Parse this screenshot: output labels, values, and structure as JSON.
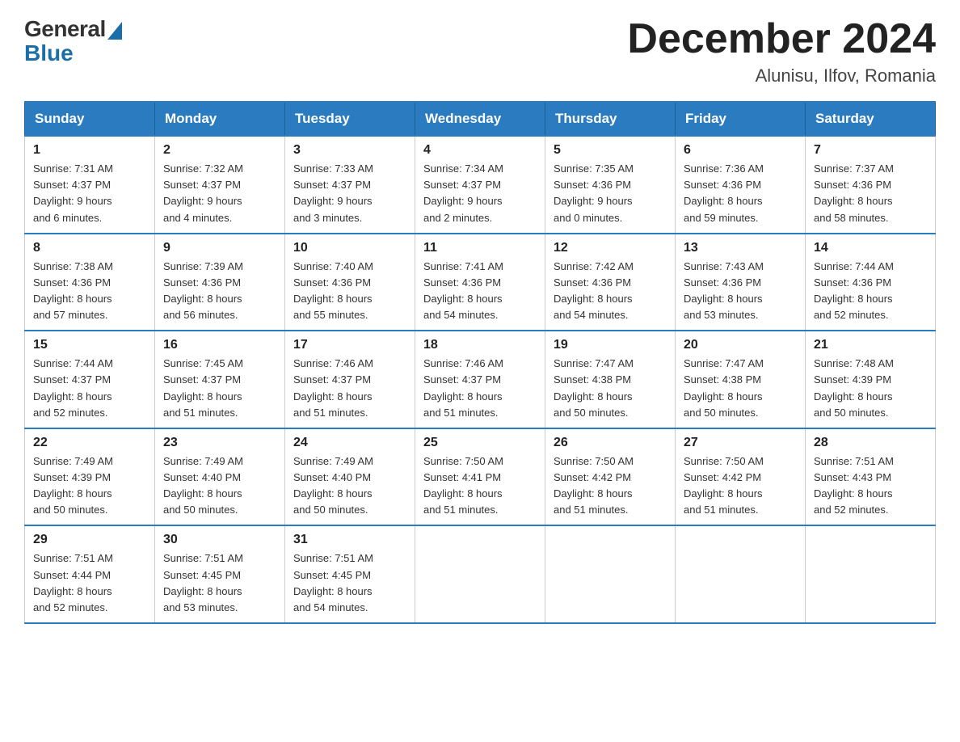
{
  "header": {
    "logo_general": "General",
    "logo_blue": "Blue",
    "month_title": "December 2024",
    "location": "Alunisu, Ilfov, Romania"
  },
  "days_of_week": [
    "Sunday",
    "Monday",
    "Tuesday",
    "Wednesday",
    "Thursday",
    "Friday",
    "Saturday"
  ],
  "weeks": [
    [
      {
        "day": "1",
        "sunrise": "7:31 AM",
        "sunset": "4:37 PM",
        "daylight": "9 hours and 6 minutes."
      },
      {
        "day": "2",
        "sunrise": "7:32 AM",
        "sunset": "4:37 PM",
        "daylight": "9 hours and 4 minutes."
      },
      {
        "day": "3",
        "sunrise": "7:33 AM",
        "sunset": "4:37 PM",
        "daylight": "9 hours and 3 minutes."
      },
      {
        "day": "4",
        "sunrise": "7:34 AM",
        "sunset": "4:37 PM",
        "daylight": "9 hours and 2 minutes."
      },
      {
        "day": "5",
        "sunrise": "7:35 AM",
        "sunset": "4:36 PM",
        "daylight": "9 hours and 0 minutes."
      },
      {
        "day": "6",
        "sunrise": "7:36 AM",
        "sunset": "4:36 PM",
        "daylight": "8 hours and 59 minutes."
      },
      {
        "day": "7",
        "sunrise": "7:37 AM",
        "sunset": "4:36 PM",
        "daylight": "8 hours and 58 minutes."
      }
    ],
    [
      {
        "day": "8",
        "sunrise": "7:38 AM",
        "sunset": "4:36 PM",
        "daylight": "8 hours and 57 minutes."
      },
      {
        "day": "9",
        "sunrise": "7:39 AM",
        "sunset": "4:36 PM",
        "daylight": "8 hours and 56 minutes."
      },
      {
        "day": "10",
        "sunrise": "7:40 AM",
        "sunset": "4:36 PM",
        "daylight": "8 hours and 55 minutes."
      },
      {
        "day": "11",
        "sunrise": "7:41 AM",
        "sunset": "4:36 PM",
        "daylight": "8 hours and 54 minutes."
      },
      {
        "day": "12",
        "sunrise": "7:42 AM",
        "sunset": "4:36 PM",
        "daylight": "8 hours and 54 minutes."
      },
      {
        "day": "13",
        "sunrise": "7:43 AM",
        "sunset": "4:36 PM",
        "daylight": "8 hours and 53 minutes."
      },
      {
        "day": "14",
        "sunrise": "7:44 AM",
        "sunset": "4:36 PM",
        "daylight": "8 hours and 52 minutes."
      }
    ],
    [
      {
        "day": "15",
        "sunrise": "7:44 AM",
        "sunset": "4:37 PM",
        "daylight": "8 hours and 52 minutes."
      },
      {
        "day": "16",
        "sunrise": "7:45 AM",
        "sunset": "4:37 PM",
        "daylight": "8 hours and 51 minutes."
      },
      {
        "day": "17",
        "sunrise": "7:46 AM",
        "sunset": "4:37 PM",
        "daylight": "8 hours and 51 minutes."
      },
      {
        "day": "18",
        "sunrise": "7:46 AM",
        "sunset": "4:37 PM",
        "daylight": "8 hours and 51 minutes."
      },
      {
        "day": "19",
        "sunrise": "7:47 AM",
        "sunset": "4:38 PM",
        "daylight": "8 hours and 50 minutes."
      },
      {
        "day": "20",
        "sunrise": "7:47 AM",
        "sunset": "4:38 PM",
        "daylight": "8 hours and 50 minutes."
      },
      {
        "day": "21",
        "sunrise": "7:48 AM",
        "sunset": "4:39 PM",
        "daylight": "8 hours and 50 minutes."
      }
    ],
    [
      {
        "day": "22",
        "sunrise": "7:49 AM",
        "sunset": "4:39 PM",
        "daylight": "8 hours and 50 minutes."
      },
      {
        "day": "23",
        "sunrise": "7:49 AM",
        "sunset": "4:40 PM",
        "daylight": "8 hours and 50 minutes."
      },
      {
        "day": "24",
        "sunrise": "7:49 AM",
        "sunset": "4:40 PM",
        "daylight": "8 hours and 50 minutes."
      },
      {
        "day": "25",
        "sunrise": "7:50 AM",
        "sunset": "4:41 PM",
        "daylight": "8 hours and 51 minutes."
      },
      {
        "day": "26",
        "sunrise": "7:50 AM",
        "sunset": "4:42 PM",
        "daylight": "8 hours and 51 minutes."
      },
      {
        "day": "27",
        "sunrise": "7:50 AM",
        "sunset": "4:42 PM",
        "daylight": "8 hours and 51 minutes."
      },
      {
        "day": "28",
        "sunrise": "7:51 AM",
        "sunset": "4:43 PM",
        "daylight": "8 hours and 52 minutes."
      }
    ],
    [
      {
        "day": "29",
        "sunrise": "7:51 AM",
        "sunset": "4:44 PM",
        "daylight": "8 hours and 52 minutes."
      },
      {
        "day": "30",
        "sunrise": "7:51 AM",
        "sunset": "4:45 PM",
        "daylight": "8 hours and 53 minutes."
      },
      {
        "day": "31",
        "sunrise": "7:51 AM",
        "sunset": "4:45 PM",
        "daylight": "8 hours and 54 minutes."
      },
      null,
      null,
      null,
      null
    ]
  ],
  "labels": {
    "sunrise": "Sunrise:",
    "sunset": "Sunset:",
    "daylight": "Daylight:"
  }
}
